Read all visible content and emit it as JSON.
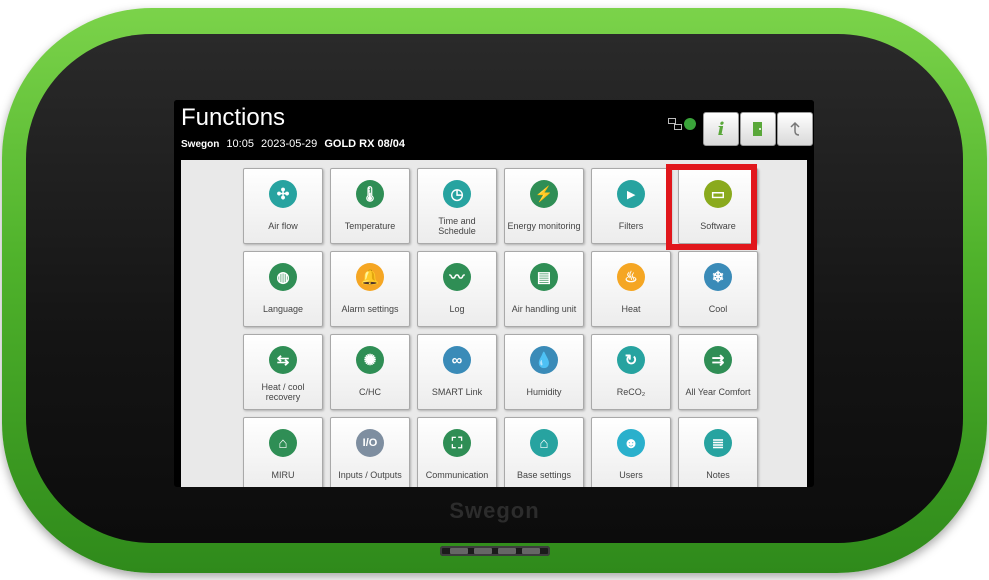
{
  "device": {
    "logo": "Swegon"
  },
  "header": {
    "title": "Functions",
    "brand": "Swegon",
    "time": "10:05",
    "date": "2023-05-29",
    "model": "GOLD RX 08/04",
    "buttons": [
      {
        "name": "info-button",
        "glyph": "i"
      },
      {
        "name": "door-button",
        "glyph": ""
      },
      {
        "name": "back-button",
        "glyph": ""
      }
    ]
  },
  "tiles": [
    {
      "label": "Air flow",
      "icon": "fan-icon",
      "color": "#27a3a0",
      "glyph": "✣"
    },
    {
      "label": "Temperature",
      "icon": "thermometer-icon",
      "color": "#2f8e55",
      "glyph": "🌡"
    },
    {
      "label": "Time and Schedule",
      "icon": "clock-icon",
      "color": "#27a3a0",
      "glyph": "◷"
    },
    {
      "label": "Energy monitoring",
      "icon": "energy-icon",
      "color": "#2f8e55",
      "glyph": "⚡"
    },
    {
      "label": "Filters",
      "icon": "filter-icon",
      "color": "#27a3a0",
      "glyph": "▸"
    },
    {
      "label": "Software",
      "icon": "chip-icon",
      "color": "#8aaa1d",
      "glyph": "▭"
    },
    {
      "label": "Language",
      "icon": "globe-icon",
      "color": "#2f8e55",
      "glyph": "◍"
    },
    {
      "label": "Alarm settings",
      "icon": "bell-icon",
      "color": "#f5a623",
      "glyph": "🔔"
    },
    {
      "label": "Log",
      "icon": "log-icon",
      "color": "#2f8e55",
      "glyph": "〰"
    },
    {
      "label": "Air handling unit",
      "icon": "ahu-icon",
      "color": "#2f8e55",
      "glyph": "▤"
    },
    {
      "label": "Heat",
      "icon": "heat-icon",
      "color": "#f5a623",
      "glyph": "♨"
    },
    {
      "label": "Cool",
      "icon": "snowflake-icon",
      "color": "#3a8bb8",
      "glyph": "❄"
    },
    {
      "label": "Heat / cool recovery",
      "icon": "recovery-icon",
      "color": "#2f8e55",
      "glyph": "⇆"
    },
    {
      "label": "C/HC",
      "icon": "chc-icon",
      "color": "#2f8e55",
      "glyph": "✺"
    },
    {
      "label": "SMART Link",
      "icon": "link-icon",
      "color": "#3a8bb8",
      "glyph": "∞"
    },
    {
      "label": "Humidity",
      "icon": "droplets-icon",
      "color": "#3a8bb8",
      "glyph": "💧"
    },
    {
      "label": "ReCO₂",
      "icon": "reco2-icon",
      "color": "#27a3a0",
      "glyph": "↻"
    },
    {
      "label": "All Year Comfort",
      "icon": "arrows-icon",
      "color": "#2f8e55",
      "glyph": "⇉"
    },
    {
      "label": "MIRU",
      "icon": "house-icon",
      "color": "#2f8e55",
      "glyph": "⌂"
    },
    {
      "label": "Inputs / Outputs",
      "icon": "io-icon",
      "color": "#7e8ea0",
      "glyph": "I/O"
    },
    {
      "label": "Communication",
      "icon": "network-icon",
      "color": "#2f8e55",
      "glyph": "⛶"
    },
    {
      "label": "Base settings",
      "icon": "factory-icon",
      "color": "#27a3a0",
      "glyph": "⌂"
    },
    {
      "label": "Users",
      "icon": "user-icon",
      "color": "#2ab0cc",
      "glyph": "☻"
    },
    {
      "label": "Notes",
      "icon": "notepad-icon",
      "color": "#27a3a0",
      "glyph": "≣"
    }
  ]
}
